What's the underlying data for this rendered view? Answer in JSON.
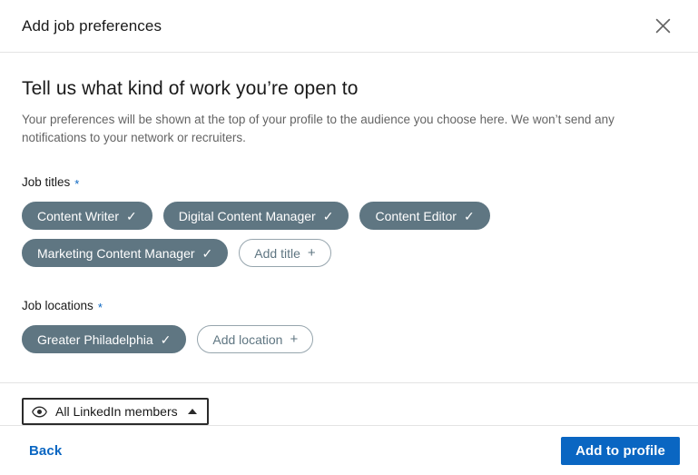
{
  "header": {
    "title": "Add job preferences",
    "close_icon": "close-icon"
  },
  "main": {
    "heading": "Tell us what kind of work you’re open to",
    "description": "Your preferences will be shown at the top of your profile to the audience you choose here. We won’t send any notifications to your network or recruiters.",
    "required_marker": "*",
    "job_titles": {
      "label": "Job titles",
      "pills": [
        {
          "label": "Content Writer",
          "selected": true,
          "check": "✓"
        },
        {
          "label": "Digital Content Manager",
          "selected": true,
          "check": "✓"
        },
        {
          "label": "Content Editor",
          "selected": true,
          "check": "✓"
        },
        {
          "label": "Marketing Content Manager",
          "selected": true,
          "check": "✓"
        }
      ],
      "add_label": "Add title",
      "add_plus": "+"
    },
    "job_locations": {
      "label": "Job locations",
      "pills": [
        {
          "label": "Greater Philadelphia",
          "selected": true,
          "check": "✓"
        }
      ],
      "add_label": "Add location",
      "add_plus": "+"
    }
  },
  "visibility": {
    "label": "All LinkedIn members",
    "eye_icon": "eye-icon",
    "caret_icon": "caret-up-icon"
  },
  "footer": {
    "back_label": "Back",
    "submit_label": "Add to profile"
  },
  "colors": {
    "accent_blue": "#0a66c2",
    "pill_slate": "#5f7682",
    "pill_outline_border": "#96a5ad",
    "divider": "#e4e4e4",
    "dropdown_border": "#2b2b2b"
  }
}
